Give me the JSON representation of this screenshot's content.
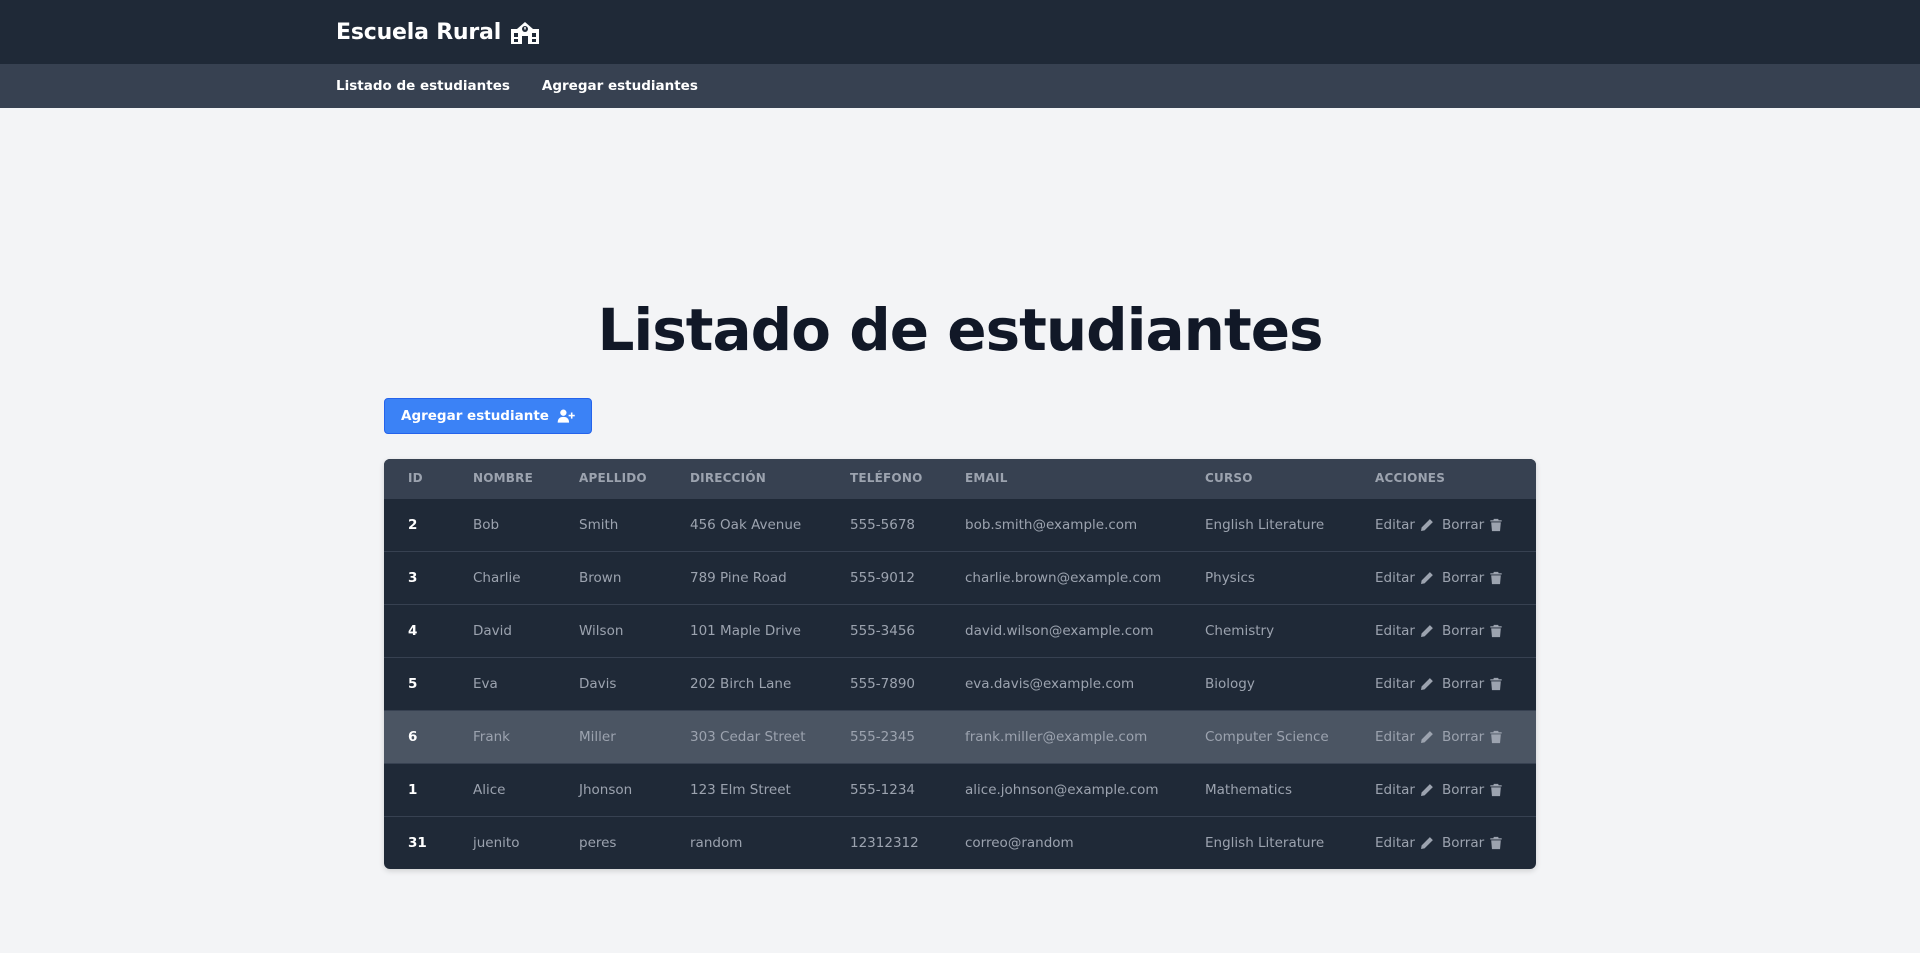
{
  "header": {
    "brand": "Escuela Rural",
    "brand_icon": "school-icon"
  },
  "nav": {
    "items": [
      "Listado de estudiantes",
      "Agregar estudiantes"
    ]
  },
  "page": {
    "title": "Listado de estudiantes"
  },
  "add_button": {
    "label": "Agregar estudiante",
    "icon": "user-plus-icon"
  },
  "table": {
    "headers": [
      "ID",
      "NOMBRE",
      "APELLIDO",
      "DIRECCIÓN",
      "TELÉFONO",
      "EMAIL",
      "CURSO",
      "ACCIONES"
    ],
    "edit_label": "Editar",
    "delete_label": "Borrar",
    "rows": [
      {
        "id": "2",
        "nombre": "Bob",
        "apellido": "Smith",
        "direccion": "456 Oak Avenue",
        "telefono": "555-5678",
        "email": "bob.smith@example.com",
        "curso": "English Literature"
      },
      {
        "id": "3",
        "nombre": "Charlie",
        "apellido": "Brown",
        "direccion": "789 Pine Road",
        "telefono": "555-9012",
        "email": "charlie.brown@example.com",
        "curso": "Physics"
      },
      {
        "id": "4",
        "nombre": "David",
        "apellido": "Wilson",
        "direccion": "101 Maple Drive",
        "telefono": "555-3456",
        "email": "david.wilson@example.com",
        "curso": "Chemistry"
      },
      {
        "id": "5",
        "nombre": "Eva",
        "apellido": "Davis",
        "direccion": "202 Birch Lane",
        "telefono": "555-7890",
        "email": "eva.davis@example.com",
        "curso": "Biology"
      },
      {
        "id": "6",
        "nombre": "Frank",
        "apellido": "Miller",
        "direccion": "303 Cedar Street",
        "telefono": "555-2345",
        "email": "frank.miller@example.com",
        "curso": "Computer Science"
      },
      {
        "id": "1",
        "nombre": "Alice",
        "apellido": "Jhonson",
        "direccion": "123 Elm Street",
        "telefono": "555-1234",
        "email": "alice.johnson@example.com",
        "curso": "Mathematics"
      },
      {
        "id": "31",
        "nombre": "juenito",
        "apellido": "peres",
        "direccion": "random",
        "telefono": "12312312",
        "email": "correo@random",
        "curso": "English Literature"
      }
    ]
  },
  "colors": {
    "header_bg": "#1f2937",
    "subnav_bg": "#374151",
    "accent": "#3b82f6",
    "page_bg": "#f3f4f6",
    "row_highlight": "#4b5563"
  }
}
